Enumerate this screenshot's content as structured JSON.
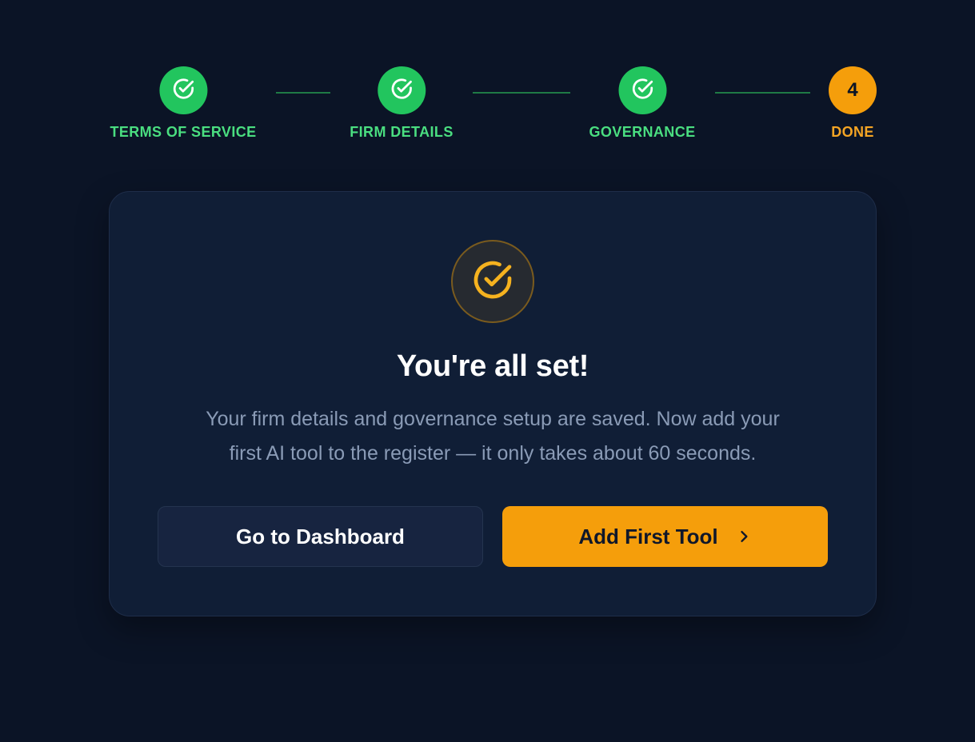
{
  "stepper": {
    "steps": [
      {
        "label": "TERMS OF SERVICE",
        "state": "complete",
        "icon": "check-circle-icon"
      },
      {
        "label": "FIRM DETAILS",
        "state": "complete",
        "icon": "check-circle-icon"
      },
      {
        "label": "GOVERNANCE",
        "state": "complete",
        "icon": "check-circle-icon"
      },
      {
        "label": "DONE",
        "state": "current",
        "number": "4"
      }
    ]
  },
  "card": {
    "icon": "check-circle-icon",
    "title": "You're all set!",
    "body_line1": "Your firm details and governance setup are saved. Now add your",
    "body_line2": "first AI tool to the register — it only takes about 60 seconds.",
    "secondary_button": "Go to Dashboard",
    "primary_button": "Add First Tool",
    "primary_button_icon": "chevron-right-icon"
  },
  "colors": {
    "background": "#0b1426",
    "card": "#101e36",
    "complete": "#22c55e",
    "accent": "#f59e0b"
  }
}
